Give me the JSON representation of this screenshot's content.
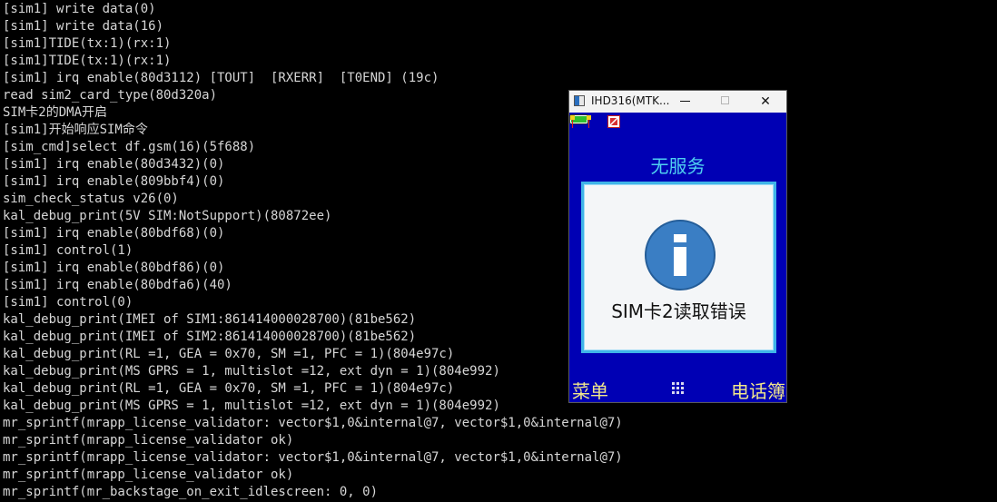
{
  "console": {
    "lines": [
      "[sim1] write data(0)",
      "[sim1] write data(16)",
      "[sim1]TIDE(tx:1)(rx:1)",
      "[sim1]TIDE(tx:1)(rx:1)",
      "[sim1] irq enable(80d3112) [TOUT]  [RXERR]  [T0END] (19c)",
      "read sim2_card_type(80d320a)",
      "SIM卡2的DMA开启",
      "[sim1]开始响应SIM命令",
      "[sim_cmd]select df.gsm(16)(5f688)",
      "[sim1] irq enable(80d3432)(0)",
      "[sim1] irq enable(809bbf4)(0)",
      "sim_check_status v26(0)",
      "kal_debug_print(5V SIM:NotSupport)(80872ee)",
      "[sim1] irq enable(80bdf68)(0)",
      "[sim1] control(1)",
      "[sim1] irq enable(80bdf86)(0)",
      "[sim1] irq enable(80bdfa6)(40)",
      "[sim1] control(0)",
      "kal_debug_print(IMEI of SIM1:861414000028700)(81be562)",
      "kal_debug_print(IMEI of SIM2:861414000028700)(81be562)",
      "kal_debug_print(RL =1, GEA = 0x70, SM =1, PFC = 1)(804e97c)",
      "kal_debug_print(MS GPRS = 1, multislot =12, ext dyn = 1)(804e992)",
      "kal_debug_print(RL =1, GEA = 0x70, SM =1, PFC = 1)(804e97c)",
      "kal_debug_print(MS GPRS = 1, multislot =12, ext dyn = 1)(804e992)",
      "mr_sprintf(mrapp_license_validator: vector$1,0&internal@7, vector$1,0&internal@7)",
      "mr_sprintf(mrapp_license_validator ok)",
      "mr_sprintf(mrapp_license_validator: vector$1,0&internal@7, vector$1,0&internal@7)",
      "mr_sprintf(mrapp_license_validator ok)",
      "mr_sprintf(mr_backstage_on_exit_idlescreen: 0, 0)"
    ]
  },
  "emulator": {
    "window_title": "IHD316(MTK...",
    "minimize_glyph": "—",
    "close_glyph": "✕",
    "network_status": "无服务",
    "dialog_message": "SIM卡2读取错误",
    "softkey_left": "菜单",
    "softkey_right": "电话簿",
    "icons": {
      "app": "app-window-icon",
      "status_1": "antenna-pin-icon",
      "status_2": "antenna-pin-icon",
      "status_3": "message-icon",
      "battery": "battery-icon",
      "dialog": "info-icon",
      "center_key": "menu-grid-icon"
    }
  },
  "colors": {
    "console_bg": "#000000",
    "console_text": "#d6d6d6",
    "phone_bg": "#0000b4",
    "network_status": "#4fd0f0",
    "softkeys": "#f0e68c",
    "dialog_border": "#3fb4e8",
    "info_icon": "#3a7ec4"
  }
}
